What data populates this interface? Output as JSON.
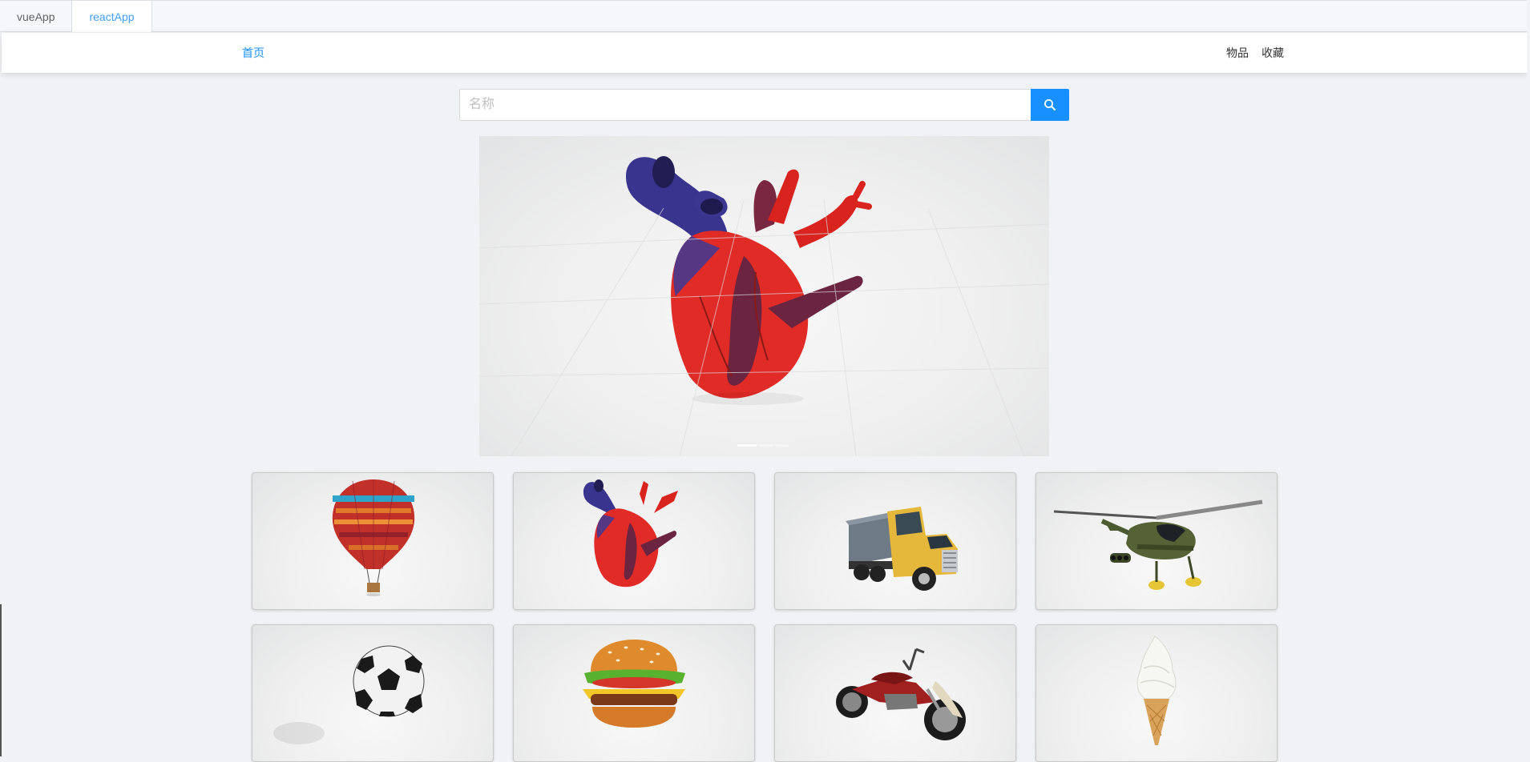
{
  "app_tabs": [
    {
      "label": "vueApp",
      "active": false
    },
    {
      "label": "reactApp",
      "active": true
    }
  ],
  "header": {
    "home": "首页",
    "items": "物品",
    "favorites": "收藏"
  },
  "search": {
    "placeholder": "名称",
    "button_icon": "search-icon"
  },
  "carousel": {
    "slide_count": 3,
    "active_slide": 1,
    "current_model": "heart"
  },
  "gallery": [
    {
      "model": "hot-air-balloon"
    },
    {
      "model": "heart"
    },
    {
      "model": "dump-truck"
    },
    {
      "model": "helicopter"
    },
    {
      "model": "soccer-ball"
    },
    {
      "model": "hamburger"
    },
    {
      "model": "motorcycle"
    },
    {
      "model": "ice-cream-cone"
    }
  ],
  "colors": {
    "accent": "#1890ff",
    "tab_active": "#409eff",
    "page_bg": "#f0f2f5"
  }
}
